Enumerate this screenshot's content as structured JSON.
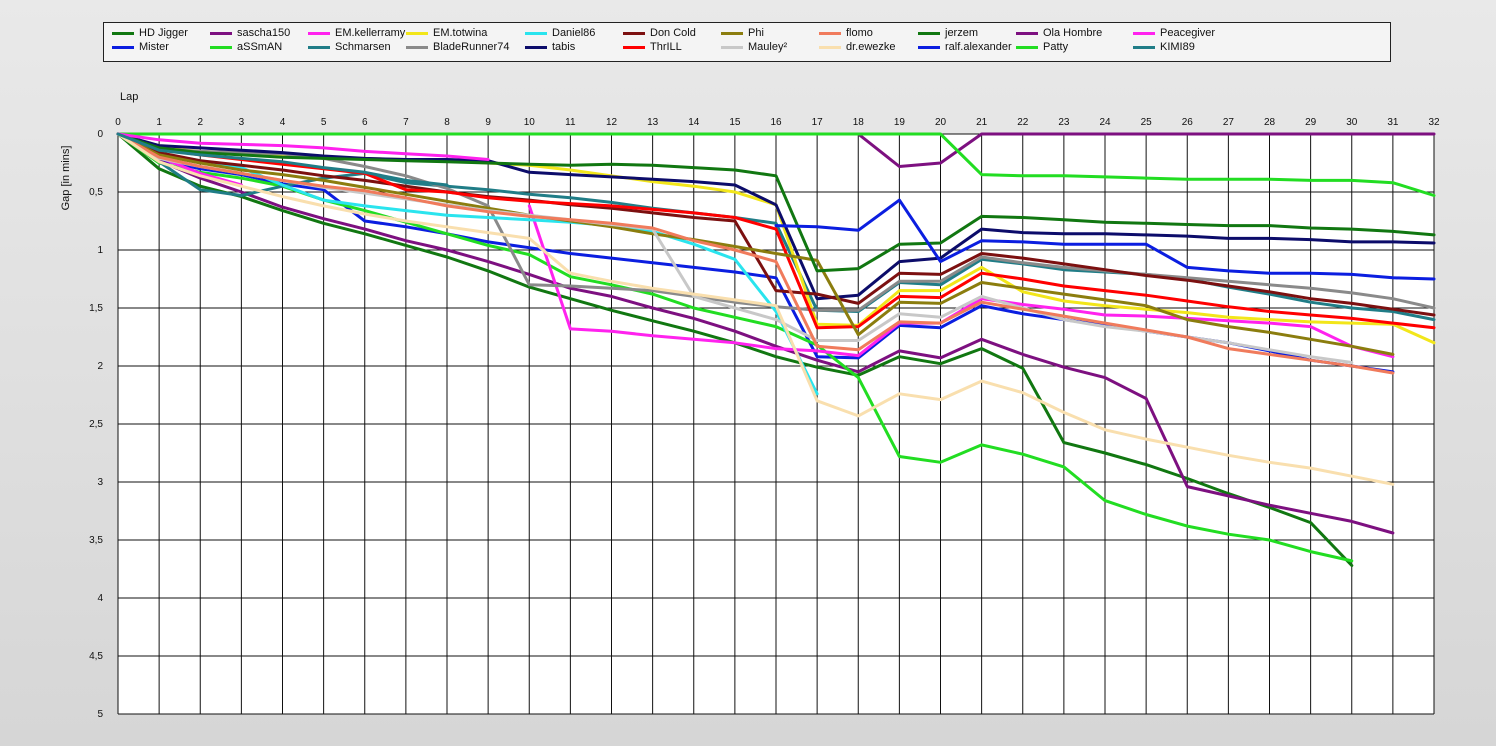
{
  "chart_data": {
    "type": "line",
    "xlabel": "Lap",
    "ylabel": "Gap [in mins]",
    "xlim": [
      0,
      32
    ],
    "ylim": [
      0,
      5
    ],
    "y_inverted": true,
    "grid": true,
    "legend_position": "top",
    "x_ticks": [
      "0",
      "1",
      "2",
      "3",
      "4",
      "5",
      "6",
      "7",
      "8",
      "9",
      "10",
      "11",
      "12",
      "13",
      "14",
      "15",
      "16",
      "17",
      "18",
      "19",
      "20",
      "21",
      "22",
      "23",
      "24",
      "25",
      "26",
      "27",
      "28",
      "29",
      "30",
      "31",
      "32"
    ],
    "y_ticks": [
      "0",
      "0,5",
      "1",
      "1,5",
      "2",
      "2,5",
      "3",
      "3,5",
      "4",
      "4,5",
      "5"
    ],
    "series": [
      {
        "name": "HD Jigger",
        "color": "#117711",
        "values": [
          0,
          0.3,
          0.45,
          0.54,
          0.66,
          0.77,
          0.86,
          0.96,
          1.06,
          1.18,
          1.32,
          1.42,
          1.52,
          1.61,
          1.7,
          1.8,
          1.92,
          2.01,
          2.08,
          1.92,
          1.98,
          1.85,
          2.02,
          2.66,
          2.75,
          2.85,
          2.97,
          3.1,
          3.22,
          3.35,
          3.72
        ]
      },
      {
        "name": "Mister",
        "color": "#0b1ee0",
        "values": [
          0,
          0.22,
          0.3,
          0.35,
          0.43,
          0.48,
          0.75,
          0.8,
          0.86,
          0.93,
          0.98,
          1.03,
          1.07,
          1.11,
          1.15,
          1.19,
          1.24,
          1.92,
          1.93,
          1.65,
          1.67,
          1.48,
          1.55,
          1.6,
          1.65,
          1.7,
          1.75,
          1.8,
          1.87,
          1.95,
          2.0,
          2.05
        ]
      },
      {
        "name": "sascha150",
        "color": "#7d1080",
        "values": [
          0,
          0.23,
          0.38,
          0.5,
          0.63,
          0.73,
          0.82,
          0.92,
          1.0,
          1.1,
          1.21,
          1.33,
          1.4,
          1.5,
          1.59,
          1.7,
          1.83,
          1.95,
          2.05,
          1.87,
          1.93,
          1.77,
          1.9,
          2.01,
          2.1,
          2.28,
          3.04,
          3.12,
          3.2,
          3.27,
          3.34,
          3.44
        ]
      },
      {
        "name": "aSSmAN",
        "color": "#22dd22",
        "values": [
          0,
          0.25,
          0.33,
          0.38,
          0.45,
          0.57,
          0.66,
          0.76,
          0.86,
          0.96,
          1.04,
          1.23,
          1.3,
          1.38,
          1.5,
          1.58,
          1.66,
          1.82,
          2.1,
          2.78,
          2.83,
          2.68,
          2.76,
          2.87,
          3.16,
          3.28,
          3.38,
          3.45,
          3.5,
          3.6,
          3.68
        ]
      },
      {
        "name": "EM.kellerramy",
        "color": "#ff22ee",
        "values": [
          0,
          0.2,
          0.34,
          0.44,
          null,
          null,
          null,
          null,
          null,
          null,
          0.62,
          1.68,
          1.7,
          1.74,
          1.77,
          1.8,
          1.85,
          1.87,
          1.91,
          1.63,
          1.63,
          1.42,
          1.47,
          1.51,
          1.56,
          1.57,
          1.59,
          1.61,
          1.63,
          1.66,
          1.83,
          1.92
        ]
      },
      {
        "name": "Schmarsen",
        "color": "#207d87",
        "values": [
          0,
          0.24,
          0.48,
          0.53,
          0.45,
          0.38,
          0.34,
          0.42,
          0.45,
          0.48,
          0.52,
          0.55,
          0.59,
          0.64,
          0.68,
          0.72,
          0.77,
          1.52,
          1.53,
          1.28,
          1.3,
          1.08,
          1.12,
          1.17,
          1.19,
          1.21,
          1.25,
          1.32,
          1.38,
          1.45,
          1.5,
          1.53,
          1.6
        ]
      },
      {
        "name": "EM.totwina",
        "color": "#f2e61a",
        "values": [
          0,
          0.12,
          0.15,
          0.17,
          0.18,
          0.2,
          0.21,
          0.22,
          0.23,
          0.25,
          0.27,
          0.31,
          0.36,
          0.41,
          0.45,
          0.5,
          0.61,
          1.64,
          1.65,
          1.35,
          1.35,
          1.15,
          1.36,
          1.44,
          1.48,
          1.51,
          1.54,
          1.58,
          1.6,
          1.62,
          1.63,
          1.64,
          1.8
        ]
      },
      {
        "name": "BladeRunner74",
        "color": "#8a8a8a",
        "values": [
          0,
          0.13,
          0.15,
          0.16,
          0.17,
          0.21,
          0.28,
          0.36,
          0.47,
          0.62,
          1.3,
          1.31,
          1.33,
          1.35,
          1.4,
          1.45,
          1.49,
          1.52,
          1.52,
          1.27,
          1.27,
          1.06,
          1.11,
          1.15,
          1.18,
          1.21,
          1.24,
          1.27,
          1.3,
          1.33,
          1.37,
          1.42,
          1.5
        ]
      },
      {
        "name": "Daniel86",
        "color": "#2ae4ee",
        "values": [
          0,
          0.17,
          0.23,
          0.29,
          0.44,
          0.57,
          0.62,
          0.66,
          0.7,
          0.72,
          0.74,
          0.76,
          0.79,
          0.84,
          0.95,
          1.08,
          1.53,
          2.24
        ]
      },
      {
        "name": "tabis",
        "color": "#0c0c6a",
        "values": [
          0,
          0.1,
          0.12,
          0.14,
          0.16,
          0.19,
          0.21,
          0.22,
          0.22,
          0.23,
          0.33,
          0.35,
          0.37,
          0.39,
          0.41,
          0.44,
          0.61,
          1.42,
          1.39,
          1.1,
          1.07,
          0.82,
          0.85,
          0.86,
          0.86,
          0.87,
          0.88,
          0.9,
          0.9,
          0.91,
          0.93,
          0.93,
          0.94
        ]
      },
      {
        "name": "Don Cold",
        "color": "#7c1010",
        "values": [
          0,
          0.16,
          0.23,
          0.27,
          0.31,
          0.36,
          0.4,
          0.45,
          0.5,
          0.54,
          0.57,
          0.61,
          0.64,
          0.68,
          0.72,
          0.75,
          1.35,
          1.38,
          1.46,
          1.2,
          1.21,
          1.03,
          1.07,
          1.12,
          1.17,
          1.22,
          1.26,
          1.31,
          1.36,
          1.42,
          1.46,
          1.51,
          1.56
        ]
      },
      {
        "name": "ThrILL",
        "color": "#ff0000",
        "values": [
          0,
          0.13,
          0.18,
          0.22,
          0.26,
          0.3,
          0.34,
          0.48,
          0.5,
          0.55,
          0.58,
          0.6,
          0.62,
          0.65,
          0.68,
          0.72,
          0.82,
          1.67,
          1.66,
          1.4,
          1.41,
          1.2,
          1.25,
          1.31,
          1.35,
          1.39,
          1.44,
          1.49,
          1.53,
          1.56,
          1.59,
          1.63,
          1.67
        ]
      },
      {
        "name": "Phi",
        "color": "#8b7d0e",
        "values": [
          0,
          0.18,
          0.25,
          0.31,
          0.35,
          0.4,
          0.46,
          0.52,
          0.58,
          0.64,
          0.7,
          0.75,
          0.8,
          0.86,
          0.91,
          0.97,
          1.03,
          1.09,
          1.73,
          1.45,
          1.46,
          1.28,
          1.33,
          1.38,
          1.43,
          1.48,
          1.6,
          1.66,
          1.71,
          1.77,
          1.83,
          1.9
        ]
      },
      {
        "name": "Mauley²",
        "color": "#c8c8c8",
        "values": [
          0,
          0.21,
          0.28,
          0.34,
          0.4,
          0.46,
          0.51,
          0.56,
          0.61,
          0.66,
          0.7,
          0.74,
          0.78,
          0.82,
          1.4,
          1.5,
          1.6,
          1.78,
          1.78,
          1.55,
          1.58,
          1.4,
          1.5,
          1.6,
          1.66,
          1.7,
          1.75,
          1.8,
          1.86,
          1.92,
          1.97
        ]
      },
      {
        "name": "flomo",
        "color": "#f07b5c",
        "values": [
          0,
          0.2,
          0.28,
          0.34,
          0.4,
          0.45,
          0.49,
          0.55,
          0.62,
          0.67,
          0.71,
          0.74,
          0.77,
          0.81,
          0.92,
          1.0,
          1.1,
          1.83,
          1.86,
          1.62,
          1.63,
          1.45,
          1.51,
          1.57,
          1.63,
          1.69,
          1.75,
          1.85,
          1.9,
          1.95,
          2.0,
          2.06
        ]
      },
      {
        "name": "dr.ewezke",
        "color": "#f9dfae",
        "values": [
          0,
          0.24,
          0.36,
          0.45,
          0.54,
          0.62,
          0.69,
          0.75,
          0.8,
          0.85,
          0.9,
          1.2,
          1.27,
          1.33,
          1.38,
          1.43,
          1.48,
          2.3,
          2.43,
          2.24,
          2.29,
          2.13,
          2.23,
          2.4,
          2.55,
          2.63,
          2.7,
          2.77,
          2.83,
          2.88,
          2.95,
          3.02
        ]
      },
      {
        "name": "jerzem",
        "color": "#117711",
        "values": [
          0,
          0.12,
          0.16,
          0.18,
          0.2,
          0.21,
          0.22,
          0.23,
          0.24,
          0.25,
          0.26,
          0.27,
          0.26,
          0.27,
          0.29,
          0.31,
          0.36,
          1.18,
          1.16,
          0.95,
          0.94,
          0.71,
          0.72,
          0.74,
          0.76,
          0.77,
          0.78,
          0.79,
          0.79,
          0.81,
          0.82,
          0.84,
          0.87
        ]
      },
      {
        "name": "ralf.alexander",
        "color": "#0b1ee0",
        "values": [
          0,
          null,
          null,
          null,
          null,
          null,
          null,
          null,
          null,
          null,
          null,
          null,
          null,
          null,
          null,
          null,
          0.79,
          0.8,
          0.83,
          0.57,
          1.1,
          0.92,
          0.93,
          0.95,
          0.95,
          0.95,
          1.15,
          1.18,
          1.2,
          1.2,
          1.21,
          1.24,
          1.25
        ]
      },
      {
        "name": "Ola Hombre",
        "color": "#7d1080",
        "values": [
          0,
          0,
          0,
          0,
          0,
          0,
          0,
          0,
          0,
          0,
          0,
          0,
          0,
          0,
          0,
          0,
          0,
          0,
          0,
          0.28,
          0.25,
          0,
          0,
          0,
          0,
          0,
          0,
          0,
          0,
          0,
          0,
          0,
          0
        ]
      },
      {
        "name": "Patty",
        "color": "#22dd22",
        "values": [
          0,
          0,
          0,
          0,
          0,
          0,
          0,
          0,
          0,
          0,
          0,
          0,
          0,
          0,
          0,
          0,
          0,
          0,
          0,
          0,
          0,
          0.35,
          0.36,
          0.36,
          0.37,
          0.38,
          0.39,
          0.39,
          0.39,
          0.4,
          0.4,
          0.42,
          0.53
        ]
      },
      {
        "name": "Peacegiver",
        "color": "#ff22ee",
        "values": [
          0,
          0.05,
          0.08,
          0.09,
          0.1,
          0.12,
          0.15,
          0.17,
          0.19,
          0.22
        ]
      },
      {
        "name": "KIMI89",
        "color": "#207d87",
        "values": [
          0,
          0.14,
          0.18,
          0.21,
          0.24,
          0.29,
          0.33,
          0.4,
          0.44
        ]
      }
    ]
  }
}
